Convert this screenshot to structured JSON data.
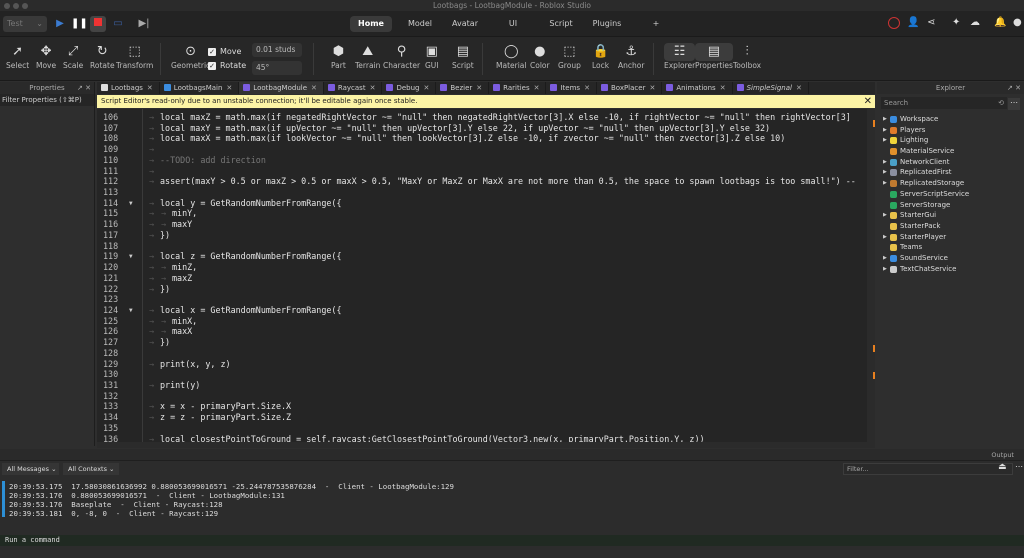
{
  "window": {
    "title": "Lootbags - LootbagModule - Roblox Studio"
  },
  "topbar": {
    "test_select": "Test",
    "nav_tabs": [
      "Home",
      "Model",
      "Avatar",
      "UI",
      "Script",
      "Plugins",
      "+"
    ],
    "active_tab": "Home"
  },
  "ribbon": {
    "tools": [
      "Select",
      "Move",
      "Scale",
      "Rotate",
      "Transform"
    ],
    "geometric": "Geometric",
    "move_label": "Move",
    "rotate_label": "Rotate",
    "move_step": "0.01 studs",
    "rotate_step": "45°",
    "insert": [
      "Part",
      "Terrain",
      "Character",
      "GUI",
      "Script"
    ],
    "edit": [
      "Material",
      "Color",
      "Group",
      "Lock",
      "Anchor"
    ],
    "windows": [
      "Explorer",
      "Properties",
      "Toolbox"
    ]
  },
  "properties": {
    "title": "Properties",
    "filter": "Filter Properties (⇧⌘P)"
  },
  "file_tabs": [
    {
      "label": "Lootbags",
      "active": false
    },
    {
      "label": "LootbagsMain",
      "active": false
    },
    {
      "label": "LootbagModule",
      "active": true
    },
    {
      "label": "Raycast",
      "active": false
    },
    {
      "label": "Debug",
      "active": false
    },
    {
      "label": "Bezier",
      "active": false
    },
    {
      "label": "Rarities",
      "active": false
    },
    {
      "label": "Items",
      "active": false
    },
    {
      "label": "BoxPlacer",
      "active": false
    },
    {
      "label": "Animations",
      "active": false
    },
    {
      "label": "SimpleSignal",
      "active": false
    }
  ],
  "banner": {
    "text": "Script Editor's read-only due to an unstable connection; it'll be editable again once stable."
  },
  "code": [
    {
      "n": "106",
      "t": "local maxZ = math.max(if negatedRightVector ~= \"null\" then negatedRightVector[3].X else -10, if rightVector ~= \"null\" then rightVector[3]",
      "i": 1
    },
    {
      "n": "107",
      "t": "local maxY = math.max(if upVector ~= \"null\" then upVector[3].Y else 22, if upVector ~= \"null\" then upVector[3].Y else 32)",
      "i": 1
    },
    {
      "n": "108",
      "t": "local maxX = math.max(if lookVector ~= \"null\" then lookVector[3].Z else -10, if zvector ~= \"null\" then zvector[3].Z else 10)",
      "i": 1
    },
    {
      "n": "109",
      "t": "",
      "i": 1
    },
    {
      "n": "110",
      "t": "--TODO: add direction",
      "i": 1,
      "comment": true
    },
    {
      "n": "111",
      "t": "",
      "i": 1
    },
    {
      "n": "112",
      "t": "assert(maxY > 0.5 or maxZ > 0.5 or maxX > 0.5, \"MaxY or MaxZ or MaxX are not more than 0.5, the space to spawn lootbags is too small!\") --",
      "i": 1
    },
    {
      "n": "113",
      "t": "",
      "i": 0
    },
    {
      "n": "114",
      "t": "local y = GetRandomNumberFromRange({",
      "i": 1,
      "fold": true
    },
    {
      "n": "115",
      "t": "minY,",
      "i": 2
    },
    {
      "n": "116",
      "t": "maxY",
      "i": 2
    },
    {
      "n": "117",
      "t": "})",
      "i": 1
    },
    {
      "n": "118",
      "t": "",
      "i": 0
    },
    {
      "n": "119",
      "t": "local z = GetRandomNumberFromRange({",
      "i": 1,
      "fold": true
    },
    {
      "n": "120",
      "t": "minZ,",
      "i": 2
    },
    {
      "n": "121",
      "t": "maxZ",
      "i": 2
    },
    {
      "n": "122",
      "t": "})",
      "i": 1
    },
    {
      "n": "123",
      "t": "",
      "i": 0
    },
    {
      "n": "124",
      "t": "local x = GetRandomNumberFromRange({",
      "i": 1,
      "fold": true
    },
    {
      "n": "125",
      "t": "minX,",
      "i": 2
    },
    {
      "n": "126",
      "t": "maxX",
      "i": 2
    },
    {
      "n": "127",
      "t": "})",
      "i": 1
    },
    {
      "n": "128",
      "t": "",
      "i": 0
    },
    {
      "n": "129",
      "t": "print(x, y, z)",
      "i": 1
    },
    {
      "n": "130",
      "t": "",
      "i": 0
    },
    {
      "n": "131",
      "t": "print(y)",
      "i": 1
    },
    {
      "n": "132",
      "t": "",
      "i": 0
    },
    {
      "n": "133",
      "t": "x = x - primaryPart.Size.X",
      "i": 1
    },
    {
      "n": "134",
      "t": "z = z - primaryPart.Size.Z",
      "i": 1
    },
    {
      "n": "135",
      "t": "",
      "i": 0
    },
    {
      "n": "136",
      "t": "local closestPointToGround = self.raycast:GetClosestPointToGround(Vector3.new(x, primaryPart.Position.Y, z))",
      "i": 1
    }
  ],
  "explorer": {
    "title": "Explorer",
    "search_placeholder": "Search",
    "items": [
      {
        "label": "Workspace",
        "exp": true,
        "color": "#3b8de0"
      },
      {
        "label": "Players",
        "exp": true,
        "color": "#e07b2b"
      },
      {
        "label": "Lighting",
        "exp": true,
        "color": "#f0d43a"
      },
      {
        "label": "MaterialService",
        "exp": false,
        "color": "#e0902b"
      },
      {
        "label": "NetworkClient",
        "exp": true,
        "color": "#4aa0c8"
      },
      {
        "label": "ReplicatedFirst",
        "exp": true,
        "color": "#8a8fa0"
      },
      {
        "label": "ReplicatedStorage",
        "exp": true,
        "color": "#c07a30"
      },
      {
        "label": "ServerScriptService",
        "exp": false,
        "color": "#2aa860"
      },
      {
        "label": "ServerStorage",
        "exp": false,
        "color": "#2aa860"
      },
      {
        "label": "StarterGui",
        "exp": true,
        "color": "#e8c24a"
      },
      {
        "label": "StarterPack",
        "exp": false,
        "color": "#e8c24a"
      },
      {
        "label": "StarterPlayer",
        "exp": true,
        "color": "#e8c24a"
      },
      {
        "label": "Teams",
        "exp": false,
        "color": "#e8c24a"
      },
      {
        "label": "SoundService",
        "exp": true,
        "color": "#3b8de0"
      },
      {
        "label": "TextChatService",
        "exp": true,
        "color": "#cccccc"
      }
    ]
  },
  "output": {
    "title": "Output",
    "messages_filter": "All Messages",
    "contexts_filter": "All Contexts",
    "filter_placeholder": "Filter...",
    "lines": [
      "20:39:53.175  17.58030861636992 0.880053699016571 -25.244787535876284  -  Client - LootbagModule:129",
      "20:39:53.176  0.880053699016571  -  Client - LootbagModule:131",
      "20:39:53.176  Baseplate  -  Client - Raycast:128",
      "20:39:53.181  0, -8, 0  -  Client - Raycast:129"
    ],
    "command_placeholder": "Run a command"
  },
  "colors": {
    "accent": "#2d8fd5",
    "banner": "#fcf4a5",
    "marker": "#e8801f"
  }
}
